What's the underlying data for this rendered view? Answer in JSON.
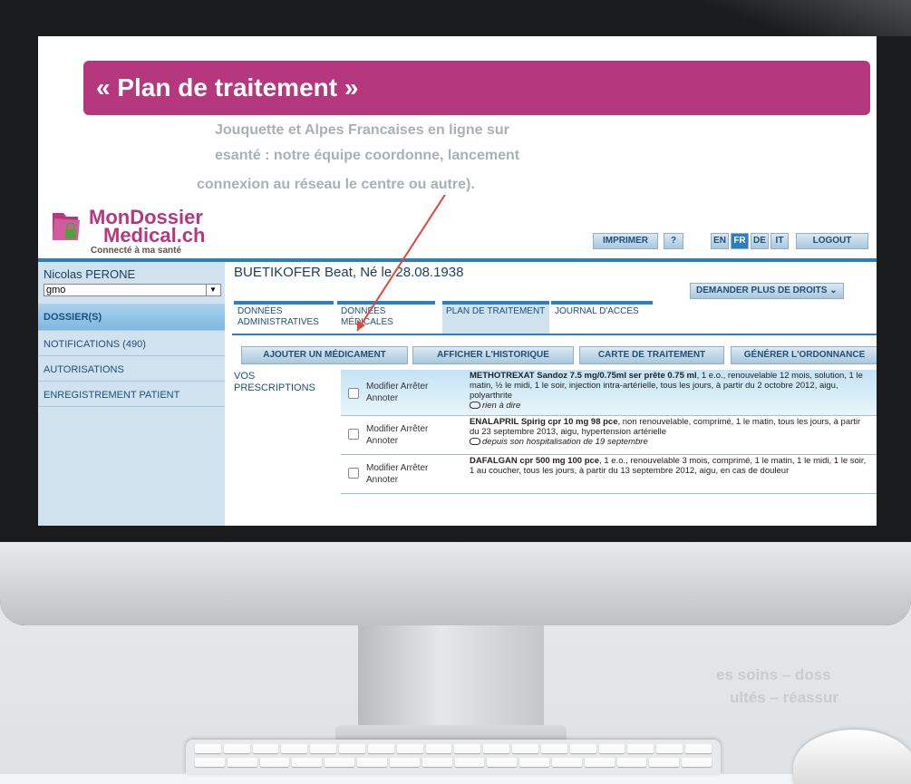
{
  "slide": {
    "title": "« Plan de traitement »"
  },
  "background_text": [
    "Jouquette et Alpes Francaises en ligne sur",
    "esanté : notre équipe coordonne, lancement",
    "connexion au réseau le centre ou autre)."
  ],
  "app": {
    "logo": {
      "line1": "MonDossier",
      "line2": "Medical.ch",
      "tagline": "Connecté à ma santé"
    },
    "topbar": {
      "print_label": "IMPRIMER",
      "help_label": "?",
      "languages": [
        "EN",
        "FR",
        "DE",
        "IT"
      ],
      "active_language": "FR",
      "logout_label": "LOGOUT"
    },
    "sidebar": {
      "user_name": "Nicolas PERONE",
      "selected_group": "gmo",
      "items": [
        {
          "label": "DOSSIER(S)",
          "active": true
        },
        {
          "label": "NOTIFICATIONS (490)"
        },
        {
          "label": "AUTORISATIONS"
        },
        {
          "label": "ENREGISTREMENT PATIENT"
        }
      ]
    },
    "patient_header": "BUETIKOFER Beat, Né le 28.08.1938",
    "more_rights_label": "DEMANDER PLUS DE DROITS ⌄",
    "tabs": [
      {
        "label": "DONNÉES ADMINISTRATIVES"
      },
      {
        "label": "DONNÉES MÉDICALES"
      },
      {
        "label": "PLAN DE TRAITEMENT",
        "active": true
      },
      {
        "label": "JOURNAL D'ACCÈS"
      }
    ],
    "actions": {
      "add_drug": "AJOUTER UN MÉDICAMENT",
      "history": "AFFICHER L'HISTORIQUE",
      "card": "CARTE DE TRAITEMENT",
      "prescription": "GÉNÉRER L'ORDONNANCE"
    },
    "prescriptions_label": "VOS PRESCRIPTIONS",
    "prescriptions": [
      {
        "actions_line1": "Modifier Arrêter",
        "actions_line2": "Annoter",
        "name": "METHOTREXAT Sandoz 7.5 mg/0.75ml ser prête 0.75 ml",
        "details": ", 1 e.o., renouvelable 12 mois, solution, 1 le matin, ½ le midi, 1 le soir, injection intra-artérielle, tous les jours, à partir du 2 octobre 2012, aigu, polyarthrite",
        "note": "rien à dire"
      },
      {
        "actions_line1": "Modifier Arrêter",
        "actions_line2": "Annoter",
        "name": "ENALAPRIL Spirig cpr 10 mg 98 pce",
        "details": ", non renouvelable, comprimé, 1 le matin, tous les jours, à partir du 23 septembre 2013, aigu, hypertension artérielle",
        "note": "depuis son hospitalisation de 19 septembre"
      },
      {
        "actions_line1": "Modifier Arrêter",
        "actions_line2": "Annoter",
        "name": "DAFALGAN cpr 500 mg 100 pce",
        "details": ", 1 e.o., renouvelable 3 mois, comprimé, 1 le matin, 1 le midi, 1 le soir, 1 au coucher, tous les jours, à partir du 13 septembre 2012, aigu, en cas de douleur",
        "note": ""
      }
    ]
  },
  "colors": {
    "brand_magenta": "#b5387e",
    "app_blue": "#2a7fc0",
    "sidebar_bg": "#cfe2ee",
    "arrow_red": "#e0453a"
  }
}
